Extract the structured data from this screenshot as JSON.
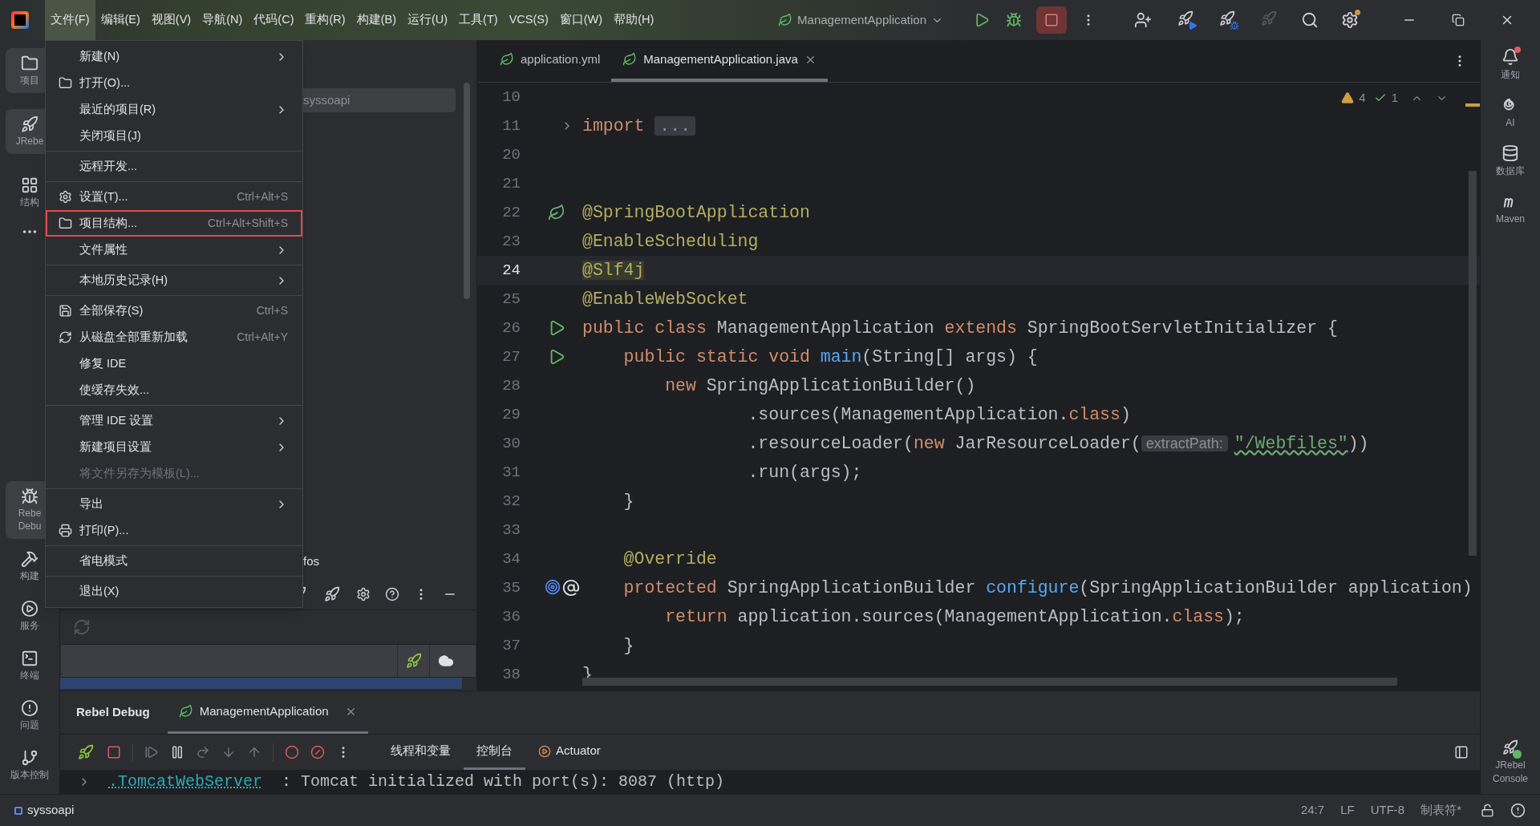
{
  "title_bar": {
    "menus": [
      {
        "label": "文件(F)",
        "selected": true
      },
      {
        "label": "编辑(E)",
        "selected": false
      },
      {
        "label": "视图(V)",
        "selected": false
      },
      {
        "label": "导航(N)",
        "selected": false
      },
      {
        "label": "代码(C)",
        "selected": false
      },
      {
        "label": "重构(R)",
        "selected": false
      },
      {
        "label": "构建(B)",
        "selected": false
      },
      {
        "label": "运行(U)",
        "selected": false
      },
      {
        "label": "工具(T)",
        "selected": false
      },
      {
        "label": "VCS(S)",
        "selected": false
      },
      {
        "label": "窗口(W)",
        "selected": false
      },
      {
        "label": "帮助(H)",
        "selected": false
      }
    ],
    "run_config": "ManagementApplication"
  },
  "left_toolbar": {
    "top": [
      {
        "label": "项目",
        "selected": true
      },
      {
        "label": "JRebe",
        "selected": true
      },
      {
        "label": "结构",
        "selected": false
      }
    ],
    "bottom": [
      {
        "label": "Rebe\nDebu",
        "selected": true
      },
      {
        "label": "构建",
        "selected": false
      },
      {
        "label": "服务",
        "selected": false
      },
      {
        "label": "终端",
        "selected": false
      },
      {
        "label": "问题",
        "selected": false
      },
      {
        "label": "版本控制",
        "selected": false
      }
    ]
  },
  "project_panel": {
    "root": "syssoapi",
    "partial_item": "fos"
  },
  "file_menu": {
    "items": [
      {
        "kind": "item",
        "label": "新建(N)",
        "submenu": true,
        "disabled": false,
        "selected": false
      },
      {
        "kind": "item",
        "label": "打开(O)...",
        "submenu": false,
        "disabled": false,
        "selected": false
      },
      {
        "kind": "item",
        "label": "最近的项目(R)",
        "submenu": true,
        "disabled": false,
        "selected": false
      },
      {
        "kind": "item",
        "label": "关闭项目(J)",
        "submenu": false,
        "disabled": false,
        "selected": false
      },
      {
        "kind": "separator"
      },
      {
        "kind": "item",
        "label": "远程开发...",
        "submenu": false,
        "disabled": false,
        "selected": false
      },
      {
        "kind": "separator"
      },
      {
        "kind": "item",
        "label": "设置(T)...",
        "shortcut": "Ctrl+Alt+S",
        "submenu": false,
        "disabled": false,
        "selected": false
      },
      {
        "kind": "item",
        "label": "项目结构...",
        "shortcut": "Ctrl+Alt+Shift+S",
        "submenu": false,
        "disabled": false,
        "selected": true
      },
      {
        "kind": "item",
        "label": "文件属性",
        "submenu": true,
        "disabled": false,
        "selected": false
      },
      {
        "kind": "separator"
      },
      {
        "kind": "item",
        "label": "本地历史记录(H)",
        "submenu": true,
        "disabled": false,
        "selected": false
      },
      {
        "kind": "separator"
      },
      {
        "kind": "item",
        "label": "全部保存(S)",
        "shortcut": "Ctrl+S",
        "submenu": false,
        "disabled": false,
        "selected": false
      },
      {
        "kind": "item",
        "label": "从磁盘全部重新加载",
        "shortcut": "Ctrl+Alt+Y",
        "submenu": false,
        "disabled": false,
        "selected": false
      },
      {
        "kind": "item",
        "label": "修复 IDE",
        "submenu": false,
        "disabled": false,
        "selected": false
      },
      {
        "kind": "item",
        "label": "使缓存失效...",
        "submenu": false,
        "disabled": false,
        "selected": false
      },
      {
        "kind": "separator"
      },
      {
        "kind": "item",
        "label": "管理 IDE 设置",
        "submenu": true,
        "disabled": false,
        "selected": false
      },
      {
        "kind": "item",
        "label": "新建项目设置",
        "submenu": true,
        "disabled": false,
        "selected": false
      },
      {
        "kind": "item",
        "label": "将文件另存为模板(L)...",
        "submenu": false,
        "disabled": true,
        "selected": false
      },
      {
        "kind": "separator"
      },
      {
        "kind": "item",
        "label": "导出",
        "submenu": true,
        "disabled": false,
        "selected": false
      },
      {
        "kind": "item",
        "label": "打印(P)...",
        "submenu": false,
        "disabled": false,
        "selected": false
      },
      {
        "kind": "separator"
      },
      {
        "kind": "item",
        "label": "省电模式",
        "submenu": false,
        "disabled": false,
        "selected": false
      },
      {
        "kind": "separator"
      },
      {
        "kind": "item",
        "label": "退出(X)",
        "submenu": false,
        "disabled": false,
        "selected": false
      }
    ]
  },
  "editor": {
    "tabs": [
      {
        "label": "application.yml",
        "selected": false,
        "closable": false
      },
      {
        "label": "ManagementApplication.java",
        "selected": true,
        "closable": true
      }
    ],
    "inspections": {
      "warnings": "4",
      "weak_warnings": "1"
    },
    "lines": [
      {
        "number": "10",
        "current": false
      },
      {
        "number": "11",
        "current": false,
        "tokens": [
          {
            "kind": "keyword",
            "text": "import "
          },
          {
            "kind": "folded",
            "text": "..."
          }
        ]
      },
      {
        "number": "20",
        "current": false
      },
      {
        "number": "21",
        "current": false
      },
      {
        "number": "22",
        "current": false,
        "tokens": [
          {
            "kind": "annotation",
            "text": "@SpringBootApplication"
          }
        ]
      },
      {
        "number": "23",
        "current": false,
        "tokens": [
          {
            "kind": "annotation",
            "text": "@EnableScheduling"
          }
        ]
      },
      {
        "number": "24",
        "current": true,
        "tokens": [
          {
            "kind": "marked",
            "text": "@Slf4j"
          }
        ]
      },
      {
        "number": "25",
        "current": false,
        "tokens": [
          {
            "kind": "annotation",
            "text": "@EnableWebSocket"
          }
        ]
      },
      {
        "number": "26",
        "current": false,
        "tokens": [
          {
            "kind": "keyword",
            "text": "public class "
          },
          {
            "kind": "plain",
            "text": "ManagementApplication "
          },
          {
            "kind": "keyword",
            "text": "extends "
          },
          {
            "kind": "plain",
            "text": "SpringBootServletInitializer {"
          }
        ]
      },
      {
        "number": "27",
        "current": false,
        "tokens": [
          {
            "kind": "keyword",
            "text": "    public static void "
          },
          {
            "kind": "method",
            "text": "main"
          },
          {
            "kind": "plain",
            "text": "(String[] args) {"
          }
        ]
      },
      {
        "number": "28",
        "current": false,
        "tokens": [
          {
            "kind": "keyword",
            "text": "        new "
          },
          {
            "kind": "plain",
            "text": "SpringApplicationBuilder()"
          }
        ]
      },
      {
        "number": "29",
        "current": false,
        "tokens": [
          {
            "kind": "plain",
            "text": "                .sources(ManagementApplication."
          },
          {
            "kind": "keyword",
            "text": "class"
          },
          {
            "kind": "plain",
            "text": ")"
          }
        ]
      },
      {
        "number": "30",
        "current": false,
        "tokens": [
          {
            "kind": "plain",
            "text": "                .resourceLoader("
          },
          {
            "kind": "keyword",
            "text": "new "
          },
          {
            "kind": "plain",
            "text": "JarResourceLoader("
          },
          {
            "kind": "hint",
            "text": "extractPath:"
          },
          {
            "kind": "string",
            "text": "\"/Webfiles\""
          },
          {
            "kind": "plain",
            "text": "))"
          }
        ]
      },
      {
        "number": "31",
        "current": false,
        "tokens": [
          {
            "kind": "plain",
            "text": "                .run(args);"
          }
        ]
      },
      {
        "number": "32",
        "current": false,
        "tokens": [
          {
            "kind": "plain",
            "text": "    }"
          }
        ]
      },
      {
        "number": "33",
        "current": false
      },
      {
        "number": "34",
        "current": false,
        "tokens": [
          {
            "kind": "annotation",
            "text": "    @Override"
          }
        ]
      },
      {
        "number": "35",
        "current": false,
        "tokens": [
          {
            "kind": "keyword",
            "text": "    protected "
          },
          {
            "kind": "plain",
            "text": "SpringApplicationBuilder "
          },
          {
            "kind": "method",
            "text": "configure"
          },
          {
            "kind": "plain",
            "text": "(SpringApplicationBuilder application)"
          }
        ]
      },
      {
        "number": "36",
        "current": false,
        "tokens": [
          {
            "kind": "keyword",
            "text": "        return "
          },
          {
            "kind": "plain",
            "text": "application.sources(ManagementApplication."
          },
          {
            "kind": "keyword",
            "text": "class"
          },
          {
            "kind": "plain",
            "text": ");"
          }
        ]
      },
      {
        "number": "37",
        "current": false,
        "tokens": [
          {
            "kind": "plain",
            "text": "    }"
          }
        ]
      },
      {
        "number": "38",
        "current": false,
        "tokens": [
          {
            "kind": "plain",
            "text": "}"
          }
        ]
      }
    ]
  },
  "right_toolbar": {
    "top": [
      "通知",
      "AI",
      "数据库",
      "Maven"
    ],
    "bottom": "JRebel\nConsole"
  },
  "bottom_panel": {
    "title": "Rebel Debug",
    "tabs": [
      {
        "label": "ManagementApplication",
        "selected": true
      }
    ],
    "subtabs": [
      {
        "label": "线程和变量",
        "selected": false
      },
      {
        "label": "控制台",
        "selected": true
      },
      {
        "label": "Actuator",
        "selected": false
      }
    ],
    "console": {
      "logger": ".TomcatWebServer",
      "message": "  : Tomcat initialized with port(s): 8087 (http)"
    }
  },
  "status_bar": {
    "project": "syssoapi",
    "items": [
      "24:7",
      "LF",
      "UTF-8",
      "制表符*"
    ]
  }
}
